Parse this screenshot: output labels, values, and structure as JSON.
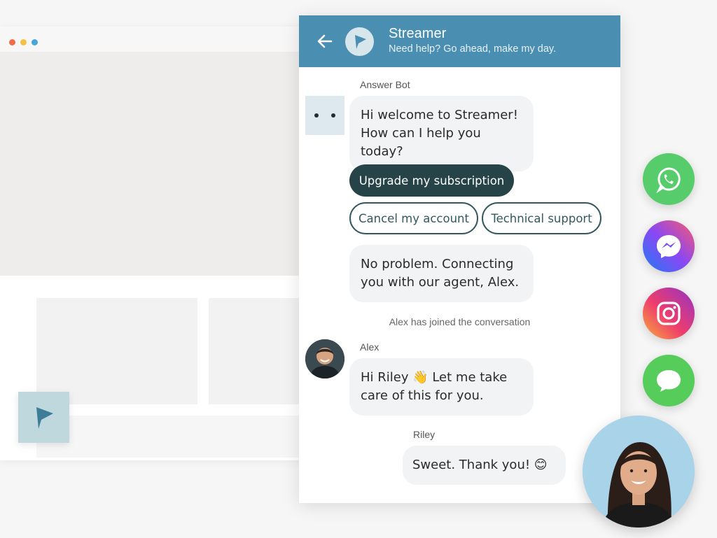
{
  "chat": {
    "header": {
      "title": "Streamer",
      "subtitle": "Need help? Go ahead, make my day."
    },
    "messages": {
      "bot_label": "Answer Bot",
      "bot_greeting_line1": "Hi welcome to Streamer!",
      "bot_greeting_line2": "How can I help you today?",
      "bot_followup_line1": "No problem. Connecting",
      "bot_followup_line2": "you with our agent, Alex.",
      "system_joined": "Alex has joined the conversation",
      "agent_label": "Alex",
      "agent_message_line1": "Hi Riley 👋 Let me take",
      "agent_message_line2": "care of this for you.",
      "user_label": "Riley",
      "user_message": "Sweet. Thank you! 😊"
    },
    "quick_replies": [
      {
        "label": "Upgrade my subscription",
        "selected": true
      },
      {
        "label": "Cancel my account",
        "selected": false
      },
      {
        "label": "Technical support",
        "selected": false
      }
    ]
  },
  "social_channels": [
    {
      "name": "WhatsApp",
      "icon": "whatsapp-icon",
      "color": "#56cc6b"
    },
    {
      "name": "Messenger",
      "icon": "messenger-icon",
      "color": "#8a47f3"
    },
    {
      "name": "Instagram",
      "icon": "instagram-icon",
      "color": "#ee3d6d"
    },
    {
      "name": "Messages",
      "icon": "sms-icon",
      "color": "#56cc5b"
    }
  ],
  "colors": {
    "header": "#4a8fb2",
    "primary_button": "#264447",
    "outline_button": "#33595e",
    "bubble": "#f1f3f4"
  }
}
